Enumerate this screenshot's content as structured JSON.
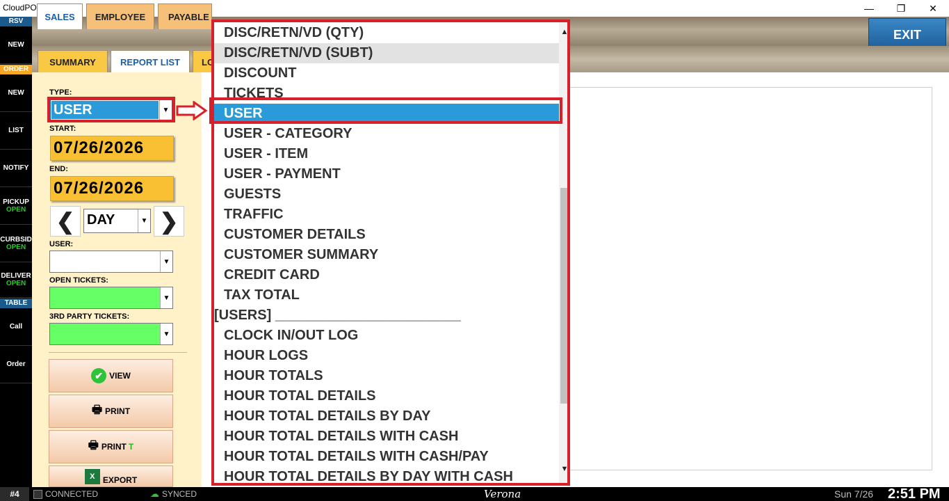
{
  "window": {
    "title": "CloudPOS",
    "minimize_glyph": "—",
    "restore_glyph": "❐",
    "close_glyph": "✕"
  },
  "sidebar": {
    "rsv_header": "RSV",
    "order_header": "ORDER",
    "table_header": "TABLE",
    "items": [
      {
        "label": "NEW",
        "sub": ""
      },
      {
        "label": "NEW",
        "sub": ""
      },
      {
        "label": "LIST",
        "sub": ""
      },
      {
        "label": "NOTIFY",
        "sub": ""
      },
      {
        "label": "PICKUP",
        "sub": "OPEN"
      },
      {
        "label": "CURBSID",
        "sub": "OPEN"
      },
      {
        "label": "DELIVER",
        "sub": "OPEN"
      },
      {
        "label": "Call",
        "sub": ""
      },
      {
        "label": "Order",
        "sub": ""
      }
    ]
  },
  "tabs": {
    "main": [
      "SALES",
      "EMPLOYEE",
      "PAYABLE"
    ],
    "sub": [
      "SUMMARY",
      "REPORT LIST",
      "LO"
    ]
  },
  "exit_label": "EXIT",
  "filters": {
    "type_label": "TYPE:",
    "type_value": "USER",
    "start_label": "START:",
    "start_date": "07/26/2026",
    "end_label": "END:",
    "end_date": "07/26/2026",
    "period_value": "DAY",
    "prev_glyph": "❮",
    "next_glyph": "❯",
    "user_label": "USER:",
    "user_value": "",
    "open_tickets_label": "OPEN TICKETS:",
    "third_party_label": "3RD PARTY TICKETS:",
    "combo_arrow": "▼"
  },
  "actions": {
    "view": "VIEW",
    "print": "PRINT",
    "print_t_prefix": "PRINT",
    "print_t_suffix": "T",
    "export": "EXPORT"
  },
  "dropdown": {
    "items": [
      {
        "label": "DISC/RETN/VD (QTY)",
        "kind": "item"
      },
      {
        "label": "DISC/RETN/VD (SUBT)",
        "kind": "hover"
      },
      {
        "label": "DISCOUNT",
        "kind": "item"
      },
      {
        "label": "TICKETS",
        "kind": "item"
      },
      {
        "label": "USER",
        "kind": "selected"
      },
      {
        "label": "USER - CATEGORY",
        "kind": "item"
      },
      {
        "label": "USER - ITEM",
        "kind": "item"
      },
      {
        "label": "USER - PAYMENT",
        "kind": "item"
      },
      {
        "label": "GUESTS",
        "kind": "item"
      },
      {
        "label": "TRAFFIC",
        "kind": "item"
      },
      {
        "label": "CUSTOMER DETAILS",
        "kind": "item"
      },
      {
        "label": "CUSTOMER SUMMARY",
        "kind": "item"
      },
      {
        "label": "CREDIT CARD",
        "kind": "item"
      },
      {
        "label": "TAX TOTAL",
        "kind": "item"
      },
      {
        "label": "[USERS] ________________________",
        "kind": "group"
      },
      {
        "label": "CLOCK IN/OUT LOG",
        "kind": "item"
      },
      {
        "label": "HOUR LOGS",
        "kind": "item"
      },
      {
        "label": "HOUR TOTALS",
        "kind": "item"
      },
      {
        "label": "HOUR TOTAL DETAILS",
        "kind": "item"
      },
      {
        "label": "HOUR TOTAL DETAILS BY DAY",
        "kind": "item"
      },
      {
        "label": "HOUR TOTAL DETAILS WITH CASH",
        "kind": "item"
      },
      {
        "label": "HOUR TOTAL DETAILS WITH CASH/PAY",
        "kind": "item"
      },
      {
        "label": "HOUR TOTAL DETAILS BY DAY WITH CASH",
        "kind": "item"
      }
    ],
    "scroll_up": "▲",
    "scroll_down": "▼"
  },
  "statusbar": {
    "station": "#4",
    "connected": "CONNECTED",
    "synced": "SYNCED",
    "location": "Verona",
    "date": "Sun 7/26",
    "time": "2:51 PM"
  },
  "colors": {
    "highlight_red": "#d8202a",
    "selected_blue": "#2a9ad8",
    "date_yellow": "#f9c033",
    "ticket_green": "#66ff66",
    "exit_blue": "#2a72b0"
  }
}
